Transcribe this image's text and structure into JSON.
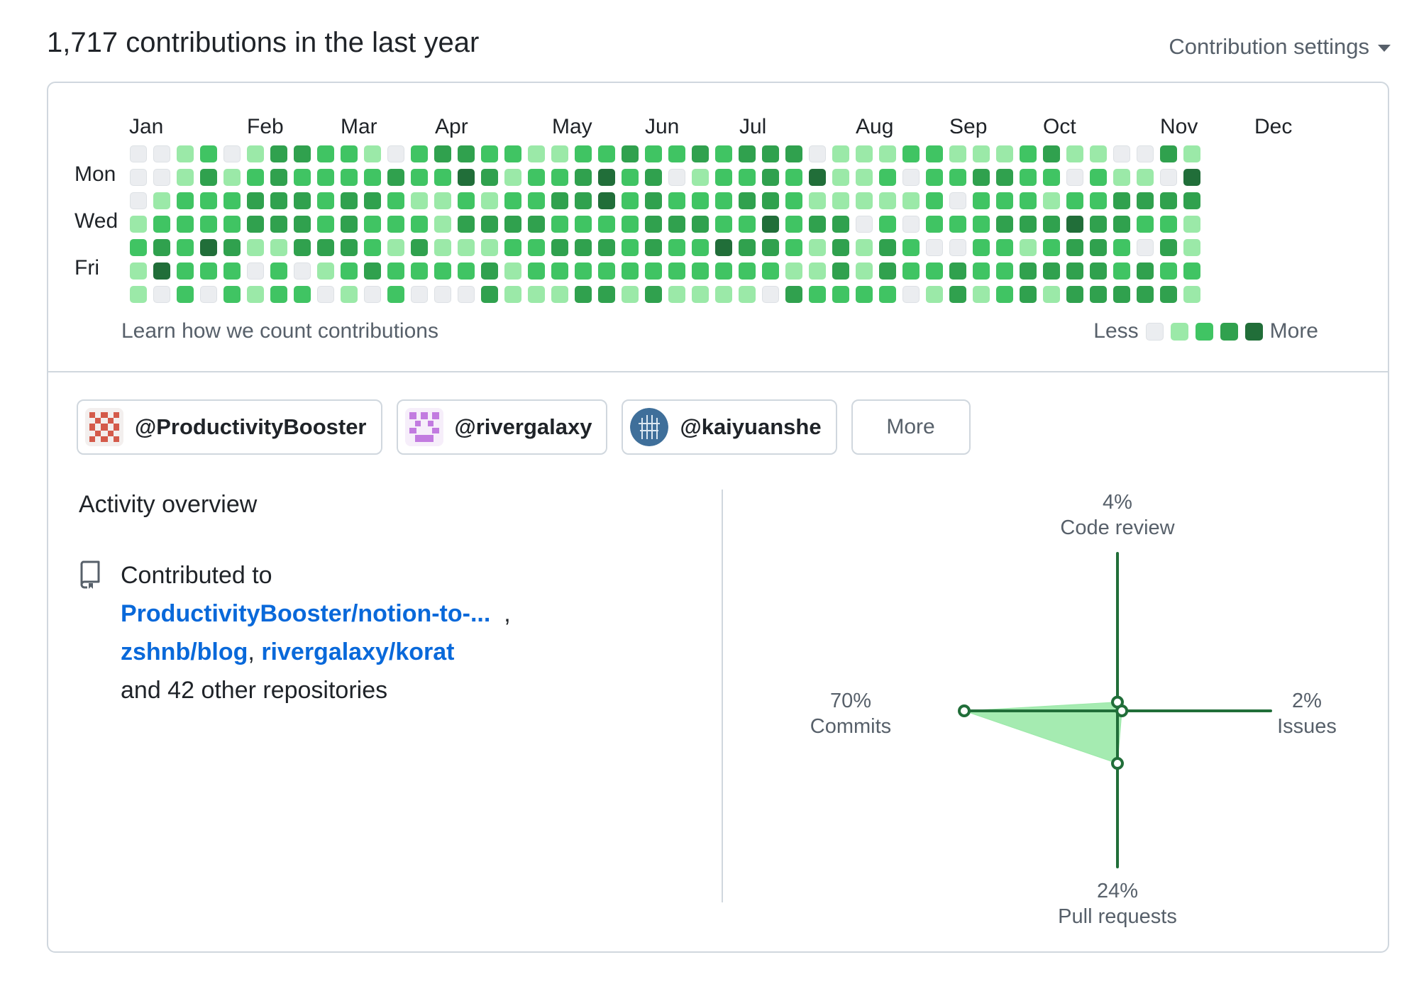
{
  "header": {
    "title": "1,717 contributions in the last year",
    "settings_label": "Contribution settings"
  },
  "calendar": {
    "months": [
      "Jan",
      "Feb",
      "Mar",
      "Apr",
      "May",
      "Jun",
      "Jul",
      "Aug",
      "Sep",
      "Oct",
      "Nov",
      "Dec"
    ],
    "day_labels": [
      "Mon",
      "Wed",
      "Fri"
    ],
    "learn_link": "Learn how we count contributions",
    "legend_less": "Less",
    "legend_more": "More",
    "colors": [
      "#ebedf0",
      "#9be9a8",
      "#40c463",
      "#30a14e",
      "#216e39"
    ],
    "levels": [
      "0012013322102332211223223233301112211123110031",
      "0013123222232243122342301223241120223322021104",
      "0122233323321121223342322233211111202221223333",
      "1222233323222133332222333224233020222333433221",
      "2324311333213111223332322433213132002212332031",
      "1422202012322223122222222222113132232233332322",
      "1020212201020003111331311110322220131231333331"
    ]
  },
  "orgs": [
    {
      "handle": "@ProductivityBooster",
      "avatar_color": "#d45a4a"
    },
    {
      "handle": "@rivergalaxy",
      "avatar_color": "#c27be0"
    },
    {
      "handle": "@kaiyuanshe",
      "avatar_color": "#3f6f9a"
    }
  ],
  "more_label": "More",
  "activity": {
    "title": "Activity overview",
    "contributed_to": "Contributed to",
    "repo1": "ProductivityBooster/notion-to-...",
    "repo2": "zshnb/blog",
    "repo3": "rivergalaxy/korat",
    "others": "and 42 other repositories"
  },
  "radar": {
    "accent": "#216e39",
    "fill": "#9be9a8",
    "axes": {
      "code_review": {
        "percent": "4%",
        "label": "Code review",
        "value": 4
      },
      "issues": {
        "percent": "2%",
        "label": "Issues",
        "value": 2
      },
      "pull_requests": {
        "percent": "24%",
        "label": "Pull requests",
        "value": 24
      },
      "commits": {
        "percent": "70%",
        "label": "Commits",
        "value": 70
      }
    }
  }
}
